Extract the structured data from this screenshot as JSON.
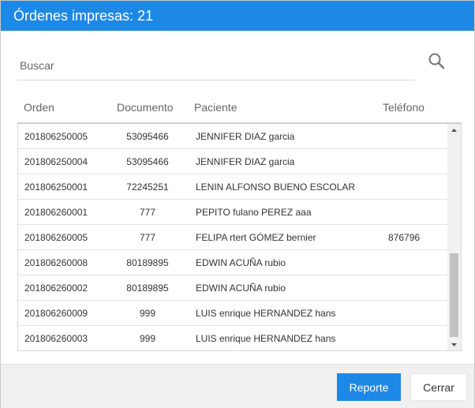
{
  "dialog": {
    "title": "Órdenes impresas: 21"
  },
  "search": {
    "placeholder": "Buscar",
    "value": ""
  },
  "table": {
    "columns": [
      "Orden",
      "Documento",
      "Paciente",
      "Teléfono"
    ],
    "rows": [
      {
        "orden": "201806250005",
        "documento": "53095466",
        "paciente": "JENNIFER DIAZ garcia",
        "telefono": ""
      },
      {
        "orden": "201806250004",
        "documento": "53095466",
        "paciente": "JENNIFER DIAZ garcia",
        "telefono": ""
      },
      {
        "orden": "201806250001",
        "documento": "72245251",
        "paciente": "LENIN ALFONSO BUENO ESCOLAR",
        "telefono": ""
      },
      {
        "orden": "201806260001",
        "documento": "777",
        "paciente": "PEPITO fulano PEREZ aaa",
        "telefono": ""
      },
      {
        "orden": "201806260005",
        "documento": "777",
        "paciente": "FELIPA rtert GÓMEZ bernier",
        "telefono": "876796"
      },
      {
        "orden": "201806260008",
        "documento": "80189895",
        "paciente": "EDWIN ACUÑA rubio",
        "telefono": ""
      },
      {
        "orden": "201806260002",
        "documento": "80189895",
        "paciente": "EDWIN ACUÑA rubio",
        "telefono": ""
      },
      {
        "orden": "201806260009",
        "documento": "999",
        "paciente": "LUIS enrique HERNANDEZ hans",
        "telefono": ""
      },
      {
        "orden": "201806260003",
        "documento": "999",
        "paciente": "LUIS enrique HERNANDEZ hans",
        "telefono": ""
      }
    ]
  },
  "footer": {
    "report_label": "Reporte",
    "close_label": "Cerrar"
  },
  "colors": {
    "accent": "#1e88e5",
    "footer_bg": "#f0f0f0"
  },
  "icons": {
    "search": "search-icon",
    "scroll_up": "triangle-up-icon",
    "scroll_down": "triangle-down-icon"
  }
}
